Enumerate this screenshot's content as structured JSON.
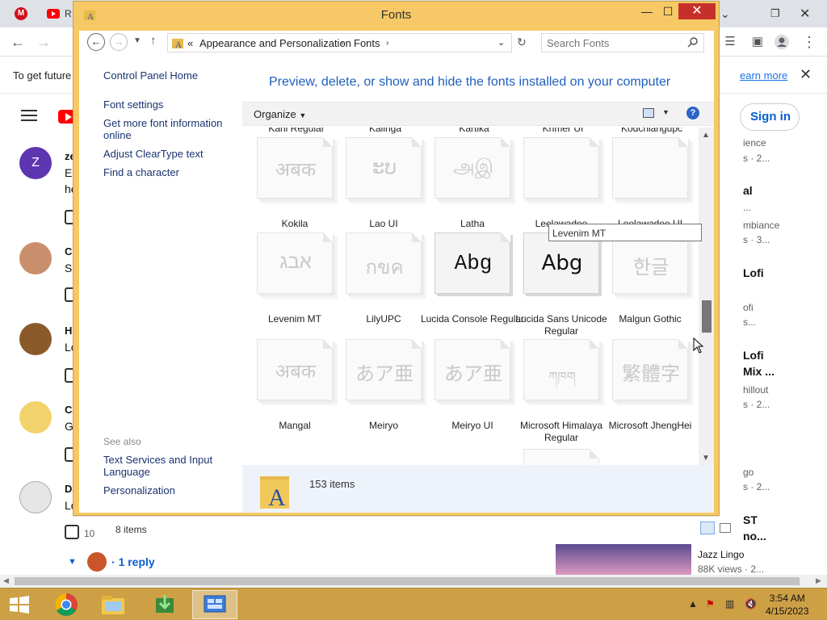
{
  "browser": {
    "tabs": [
      {
        "label": "R"
      }
    ],
    "infobar": {
      "text": "To get future",
      "more_link": "earn more"
    },
    "header": {
      "signin": "Sign in"
    },
    "comments": [
      {
        "name": "ze",
        "text": "Ex",
        "text2": "he",
        "avatar_letter": "Z"
      },
      {
        "name": "Cl",
        "text": "Sc"
      },
      {
        "name": "H",
        "text": "Lo"
      },
      {
        "name": "Ca",
        "text": "G"
      },
      {
        "name": "Da",
        "text": "Lo"
      }
    ],
    "like_count": "10",
    "replies_label": "1 reply",
    "right_items": [
      "ience",
      "s · 2...",
      "al",
      "...",
      "mbiance",
      "s · 3...",
      "Lofi",
      "ofi",
      "s...",
      "Lofi",
      "Mix ...",
      "hillout",
      "s · 2...",
      "go",
      "s · 2...",
      "ST",
      "no..."
    ],
    "video_card": {
      "title": "Jazz Lingo",
      "meta": "88K views · 2..."
    }
  },
  "window": {
    "title": "Fonts",
    "controls": {
      "minimize": "—",
      "maximize": "☐",
      "close": "✕"
    },
    "address": {
      "chevrons": "«",
      "crumbs": [
        "Appearance and Personalization",
        "Fonts"
      ]
    },
    "search": {
      "placeholder": "Search Fonts"
    },
    "left_pane": {
      "links": [
        "Control Panel Home",
        "Font settings",
        "Get more font information online",
        "Adjust ClearType text",
        "Find a character"
      ],
      "see_also_label": "See also",
      "see_also_links": [
        "Text Services and Input Language",
        "Personalization"
      ]
    },
    "headline": "Preview, delete, or show and hide the fonts installed on your computer",
    "toolbar": {
      "organize": "Organize"
    },
    "partial_row": [
      "Kani Regular",
      "Kalinga",
      "Kartika",
      "Khmer UI",
      "Kodchiangupc"
    ],
    "fonts": [
      {
        "name": "Kokila",
        "sample": "अबक",
        "hidden": true
      },
      {
        "name": "Lao UI",
        "sample": "ະບ",
        "hidden": true
      },
      {
        "name": "Latha",
        "sample": "அஇ",
        "hidden": true
      },
      {
        "name": "Leelawadee",
        "sample": "",
        "hidden": true
      },
      {
        "name": "Leelawadee UI",
        "sample": "",
        "hidden": true
      },
      {
        "name": "Levenim MT",
        "sample": "אבג",
        "hidden": true
      },
      {
        "name": "LilyUPC",
        "sample": "กขค",
        "hidden": true
      },
      {
        "name": "Lucida Console Regular",
        "sample": "Abg",
        "hidden": false
      },
      {
        "name": "Lucida Sans Unicode Regular",
        "sample": "Abg",
        "hidden": false
      },
      {
        "name": "Malgun Gothic",
        "sample": "한글",
        "hidden": true
      },
      {
        "name": "Mangal",
        "sample": "अबक",
        "hidden": true
      },
      {
        "name": "Meiryo",
        "sample": "あア亜",
        "hidden": true
      },
      {
        "name": "Meiryo UI",
        "sample": "あア亜",
        "hidden": true
      },
      {
        "name": "Microsoft Himalaya Regular",
        "sample": "ཀཁག",
        "hidden": true
      },
      {
        "name": "Microsoft JhengHei",
        "sample": "繁體字",
        "hidden": true
      }
    ],
    "tooltip": "Levenim MT",
    "details": {
      "count": "153 items"
    },
    "status": {
      "count": "8 items"
    }
  },
  "taskbar": {
    "time": "3:54 AM",
    "date": "4/15/2023"
  }
}
